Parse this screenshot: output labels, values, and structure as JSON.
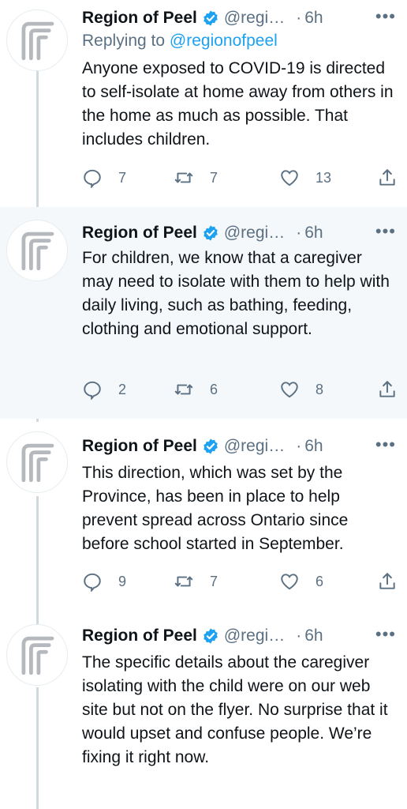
{
  "tweets": [
    {
      "name": "Region of Peel",
      "handle": "@regi…",
      "time": "6h",
      "reply_prefix": "Replying to",
      "reply_to": "@regionofpeel",
      "text": "Anyone exposed to COVID-19 is directed to self-isolate at home away from others in the home as much as possible. That includes children.",
      "replies": "7",
      "retweets": "7",
      "likes": "13"
    },
    {
      "name": "Region of Peel",
      "handle": "@regi…",
      "time": "6h",
      "text": "For children, we know that a caregiver may need to isolate with them to help with daily living, such as bathing, feeding, clothing and emotional support.",
      "replies": "2",
      "retweets": "6",
      "likes": "8"
    },
    {
      "name": "Region of Peel",
      "handle": "@regi…",
      "time": "6h",
      "text": "This direction, which was set by the Province, has been in place to help prevent spread across Ontario since before school started in September.",
      "replies": "9",
      "retweets": "7",
      "likes": "6"
    },
    {
      "name": "Region of Peel",
      "handle": "@regi…",
      "time": "6h",
      "text": "The specific details about the caregiver isolating with the child were on our web site but not on the flyer. No surprise that it would upset and confuse people. We’re fixing it right now."
    }
  ],
  "ui": {
    "dot": "·",
    "more": "•••"
  },
  "icons": {
    "avatar": "region-of-peel-logo",
    "verified": "verified-badge-icon",
    "reply": "reply-icon",
    "retweet": "retweet-icon",
    "like": "heart-icon",
    "share": "share-icon"
  },
  "colors": {
    "accent": "#1da1f2",
    "muted": "#5b7083",
    "highlight_bg": "#f5f8fa"
  }
}
